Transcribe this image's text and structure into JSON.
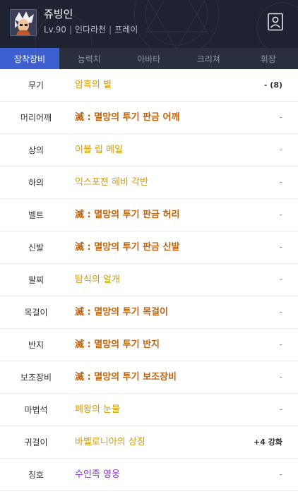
{
  "header": {
    "name": "쥬빙인",
    "level": "Lv.90",
    "world": "인다라천",
    "job": "프레이",
    "separator": "|",
    "profile_icon": "person-card-icon",
    "avatar_icon": "character-avatar-icon"
  },
  "tabs": [
    {
      "label": "장착장비",
      "active": true
    },
    {
      "label": "능력치",
      "active": false
    },
    {
      "label": "아바타",
      "active": false
    },
    {
      "label": "크리쳐",
      "active": false
    },
    {
      "label": "휘장",
      "active": false
    }
  ],
  "colors": {
    "tab_active": "#3d5fd0",
    "legendary": "#d89b00",
    "unique": "#c06410",
    "title": "#8a2be2"
  },
  "equipment": [
    {
      "slot": "무기",
      "item": "암흑의 별",
      "grade": "legendary",
      "right": "- (8)",
      "right_strong": true
    },
    {
      "slot": "머리어깨",
      "item": "滅 : 멸망의 투기 판금 어깨",
      "grade": "unique",
      "right": "-",
      "right_strong": false
    },
    {
      "slot": "상의",
      "item": "이블 립 메일",
      "grade": "legendary",
      "right": "-",
      "right_strong": false
    },
    {
      "slot": "하의",
      "item": "익스포젼 헤비 각반",
      "grade": "legendary",
      "right": "-",
      "right_strong": false
    },
    {
      "slot": "벨트",
      "item": "滅 : 멸망의 투기 판금 허리",
      "grade": "unique",
      "right": "-",
      "right_strong": false
    },
    {
      "slot": "신발",
      "item": "滅 : 멸망의 투기 판금 신발",
      "grade": "unique",
      "right": "-",
      "right_strong": false
    },
    {
      "slot": "팔찌",
      "item": "탐식의 얼개",
      "grade": "legendary",
      "right": "-",
      "right_strong": false
    },
    {
      "slot": "목걸이",
      "item": "滅 : 멸망의 투기 목걸이",
      "grade": "unique",
      "right": "-",
      "right_strong": false
    },
    {
      "slot": "반지",
      "item": "滅 : 멸망의 투기 반지",
      "grade": "unique",
      "right": "-",
      "right_strong": false
    },
    {
      "slot": "보조장비",
      "item": "滅 : 멸망의 투기 보조장비",
      "grade": "unique",
      "right": "-",
      "right_strong": false
    },
    {
      "slot": "마법석",
      "item": "폐왕의 눈물",
      "grade": "legendary",
      "right": "-",
      "right_strong": false
    },
    {
      "slot": "귀걸이",
      "item": "바벨로니아의 상징",
      "grade": "legendary",
      "right": "+4 강화",
      "right_strong": true
    },
    {
      "slot": "칭호",
      "item": "수인족 영웅",
      "grade": "title",
      "right": "-",
      "right_strong": false
    }
  ]
}
